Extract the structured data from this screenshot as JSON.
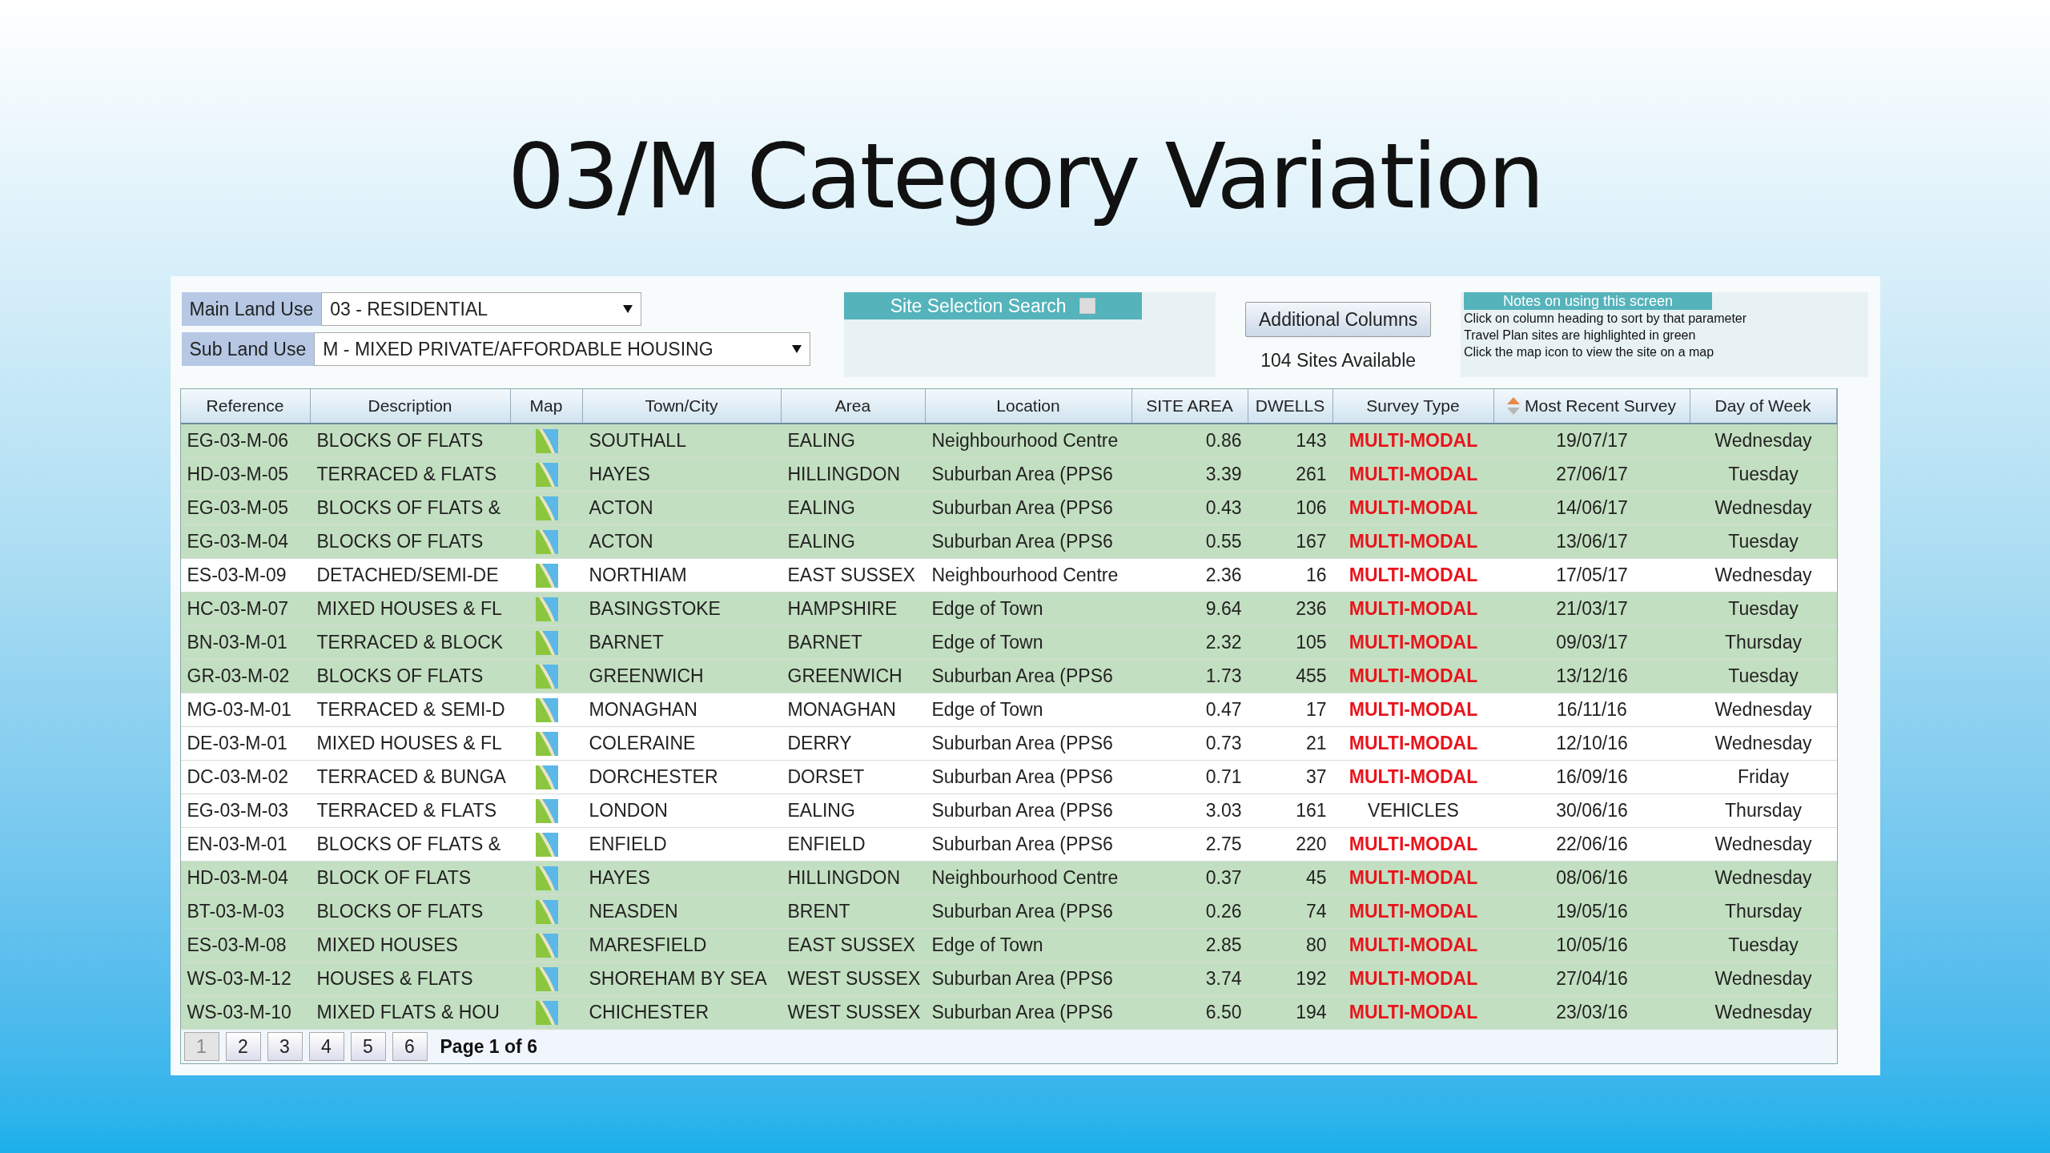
{
  "slide_title": "03/M Category Variation",
  "filters": [
    {
      "label": "Main Land Use",
      "value": "03 - RESIDENTIAL"
    },
    {
      "label": "Sub Land Use",
      "value": "M - MIXED PRIVATE/AFFORDABLE HOUSING"
    }
  ],
  "site_selection": {
    "title": "Site Selection Search",
    "checked": false
  },
  "additional_columns_button": "Additional Columns",
  "sites_available": "104 Sites Available",
  "notes": {
    "title": "Notes on using this screen",
    "lines": [
      "Click on column heading to sort by that parameter",
      "Travel Plan sites are highlighted in green",
      "Click the map icon to view the site on a map"
    ]
  },
  "table": {
    "columns": [
      {
        "label": "Reference",
        "sorted": false
      },
      {
        "label": "Description",
        "sorted": false
      },
      {
        "label": "Map",
        "sorted": false
      },
      {
        "label": "Town/City",
        "sorted": false
      },
      {
        "label": "Area",
        "sorted": false
      },
      {
        "label": "Location",
        "sorted": false
      },
      {
        "label": "SITE AREA",
        "sorted": false
      },
      {
        "label": "DWELLS",
        "sorted": false
      },
      {
        "label": "Survey Type",
        "sorted": false
      },
      {
        "label": "Most Recent Survey",
        "sorted": true
      },
      {
        "label": "Day of Week",
        "sorted": false
      }
    ],
    "rows": [
      {
        "reference": "EG-03-M-06",
        "description": "BLOCKS OF FLATS",
        "town": "SOUTHALL",
        "area": "EALING",
        "location": "Neighbourhood Centre",
        "site_area": "0.86",
        "dwells": "143",
        "survey_type": "MULTI-MODAL",
        "multi_modal": true,
        "date": "19/07/17",
        "day": "Wednesday",
        "travel_plan": true
      },
      {
        "reference": "HD-03-M-05",
        "description": "TERRACED & FLATS",
        "town": "HAYES",
        "area": "HILLINGDON",
        "location": "Suburban Area (PPS6",
        "site_area": "3.39",
        "dwells": "261",
        "survey_type": "MULTI-MODAL",
        "multi_modal": true,
        "date": "27/06/17",
        "day": "Tuesday",
        "travel_plan": true
      },
      {
        "reference": "EG-03-M-05",
        "description": "BLOCKS OF FLATS &",
        "town": "ACTON",
        "area": "EALING",
        "location": "Suburban Area (PPS6",
        "site_area": "0.43",
        "dwells": "106",
        "survey_type": "MULTI-MODAL",
        "multi_modal": true,
        "date": "14/06/17",
        "day": "Wednesday",
        "travel_plan": true
      },
      {
        "reference": "EG-03-M-04",
        "description": "BLOCKS OF FLATS",
        "town": "ACTON",
        "area": "EALING",
        "location": "Suburban Area (PPS6",
        "site_area": "0.55",
        "dwells": "167",
        "survey_type": "MULTI-MODAL",
        "multi_modal": true,
        "date": "13/06/17",
        "day": "Tuesday",
        "travel_plan": true
      },
      {
        "reference": "ES-03-M-09",
        "description": "DETACHED/SEMI-DE",
        "town": "NORTHIAM",
        "area": "EAST SUSSEX",
        "location": "Neighbourhood Centre",
        "site_area": "2.36",
        "dwells": "16",
        "survey_type": "MULTI-MODAL",
        "multi_modal": true,
        "date": "17/05/17",
        "day": "Wednesday",
        "travel_plan": false
      },
      {
        "reference": "HC-03-M-07",
        "description": "MIXED HOUSES & FL",
        "town": "BASINGSTOKE",
        "area": "HAMPSHIRE",
        "location": "Edge of Town",
        "site_area": "9.64",
        "dwells": "236",
        "survey_type": "MULTI-MODAL",
        "multi_modal": true,
        "date": "21/03/17",
        "day": "Tuesday",
        "travel_plan": true
      },
      {
        "reference": "BN-03-M-01",
        "description": "TERRACED & BLOCK",
        "town": "BARNET",
        "area": "BARNET",
        "location": "Edge of Town",
        "site_area": "2.32",
        "dwells": "105",
        "survey_type": "MULTI-MODAL",
        "multi_modal": true,
        "date": "09/03/17",
        "day": "Thursday",
        "travel_plan": true
      },
      {
        "reference": "GR-03-M-02",
        "description": "BLOCKS OF FLATS",
        "town": "GREENWICH",
        "area": "GREENWICH",
        "location": "Suburban Area (PPS6",
        "site_area": "1.73",
        "dwells": "455",
        "survey_type": "MULTI-MODAL",
        "multi_modal": true,
        "date": "13/12/16",
        "day": "Tuesday",
        "travel_plan": true
      },
      {
        "reference": "MG-03-M-01",
        "description": "TERRACED & SEMI-D",
        "town": "MONAGHAN",
        "area": "MONAGHAN",
        "location": "Edge of Town",
        "site_area": "0.47",
        "dwells": "17",
        "survey_type": "MULTI-MODAL",
        "multi_modal": true,
        "date": "16/11/16",
        "day": "Wednesday",
        "travel_plan": false
      },
      {
        "reference": "DE-03-M-01",
        "description": "MIXED HOUSES & FL",
        "town": "COLERAINE",
        "area": "DERRY",
        "location": "Suburban Area (PPS6",
        "site_area": "0.73",
        "dwells": "21",
        "survey_type": "MULTI-MODAL",
        "multi_modal": true,
        "date": "12/10/16",
        "day": "Wednesday",
        "travel_plan": false
      },
      {
        "reference": "DC-03-M-02",
        "description": "TERRACED & BUNGA",
        "town": "DORCHESTER",
        "area": "DORSET",
        "location": "Suburban Area (PPS6",
        "site_area": "0.71",
        "dwells": "37",
        "survey_type": "MULTI-MODAL",
        "multi_modal": true,
        "date": "16/09/16",
        "day": "Friday",
        "travel_plan": false
      },
      {
        "reference": "EG-03-M-03",
        "description": "TERRACED & FLATS",
        "town": "LONDON",
        "area": "EALING",
        "location": "Suburban Area (PPS6",
        "site_area": "3.03",
        "dwells": "161",
        "survey_type": "VEHICLES",
        "multi_modal": false,
        "date": "30/06/16",
        "day": "Thursday",
        "travel_plan": false
      },
      {
        "reference": "EN-03-M-01",
        "description": "BLOCKS OF FLATS &",
        "town": "ENFIELD",
        "area": "ENFIELD",
        "location": "Suburban Area (PPS6",
        "site_area": "2.75",
        "dwells": "220",
        "survey_type": "MULTI-MODAL",
        "multi_modal": true,
        "date": "22/06/16",
        "day": "Wednesday",
        "travel_plan": false
      },
      {
        "reference": "HD-03-M-04",
        "description": "BLOCK OF FLATS",
        "town": "HAYES",
        "area": "HILLINGDON",
        "location": "Neighbourhood Centre",
        "site_area": "0.37",
        "dwells": "45",
        "survey_type": "MULTI-MODAL",
        "multi_modal": true,
        "date": "08/06/16",
        "day": "Wednesday",
        "travel_plan": true
      },
      {
        "reference": "BT-03-M-03",
        "description": "BLOCKS OF FLATS",
        "town": "NEASDEN",
        "area": "BRENT",
        "location": "Suburban Area (PPS6",
        "site_area": "0.26",
        "dwells": "74",
        "survey_type": "MULTI-MODAL",
        "multi_modal": true,
        "date": "19/05/16",
        "day": "Thursday",
        "travel_plan": true
      },
      {
        "reference": "ES-03-M-08",
        "description": "MIXED HOUSES",
        "town": "MARESFIELD",
        "area": "EAST SUSSEX",
        "location": "Edge of Town",
        "site_area": "2.85",
        "dwells": "80",
        "survey_type": "MULTI-MODAL",
        "multi_modal": true,
        "date": "10/05/16",
        "day": "Tuesday",
        "travel_plan": true
      },
      {
        "reference": "WS-03-M-12",
        "description": "HOUSES & FLATS",
        "town": "SHOREHAM BY SEA",
        "area": "WEST SUSSEX",
        "location": "Suburban Area (PPS6",
        "site_area": "3.74",
        "dwells": "192",
        "survey_type": "MULTI-MODAL",
        "multi_modal": true,
        "date": "27/04/16",
        "day": "Wednesday",
        "travel_plan": true
      },
      {
        "reference": "WS-03-M-10",
        "description": "MIXED FLATS & HOU",
        "town": "CHICHESTER",
        "area": "WEST SUSSEX",
        "location": "Suburban Area (PPS6",
        "site_area": "6.50",
        "dwells": "194",
        "survey_type": "MULTI-MODAL",
        "multi_modal": true,
        "date": "23/03/16",
        "day": "Wednesday",
        "travel_plan": true
      }
    ]
  },
  "pager": {
    "pages": [
      {
        "label": "1",
        "selected": true
      },
      {
        "label": "2",
        "selected": false
      },
      {
        "label": "3",
        "selected": false
      },
      {
        "label": "4",
        "selected": false
      },
      {
        "label": "5",
        "selected": false
      },
      {
        "label": "6",
        "selected": false
      }
    ],
    "status": "Page 1 of 6"
  }
}
